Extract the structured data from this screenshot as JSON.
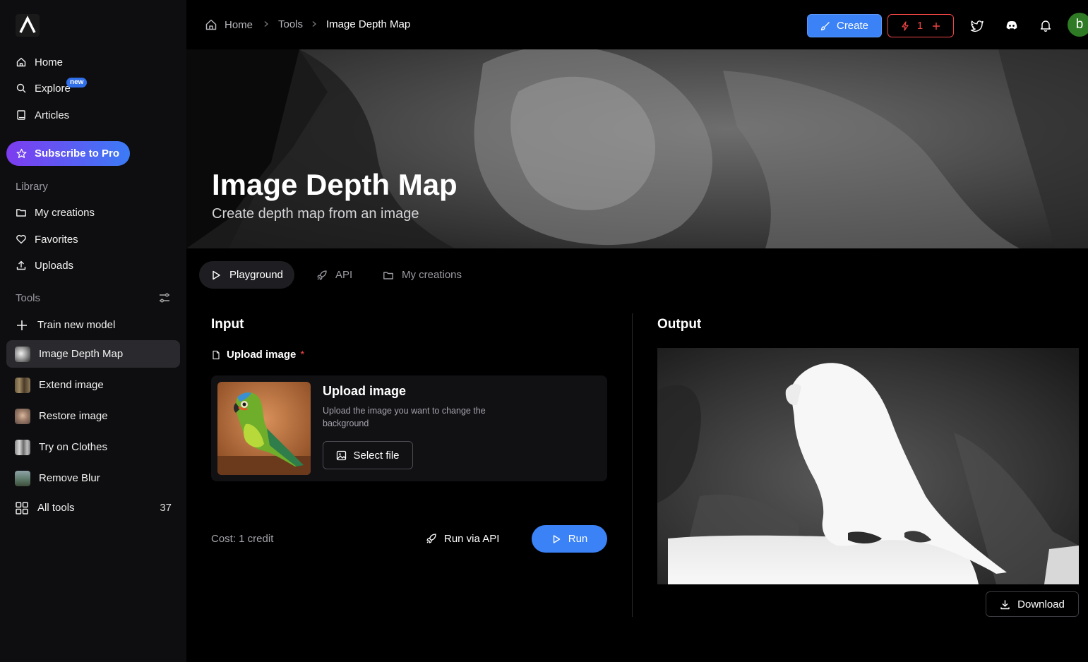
{
  "sidebar": {
    "logo": "app-logo",
    "nav": [
      {
        "label": "Home",
        "icon": "home-icon"
      },
      {
        "label": "Explore",
        "icon": "search-icon",
        "badge": "new"
      },
      {
        "label": "Articles",
        "icon": "book-icon"
      }
    ],
    "pro_button": "Subscribe to Pro",
    "library_label": "Library",
    "library": [
      {
        "label": "My creations",
        "icon": "folder-icon"
      },
      {
        "label": "Favorites",
        "icon": "heart-icon"
      },
      {
        "label": "Uploads",
        "icon": "upload-icon"
      }
    ],
    "tools_label": "Tools",
    "tools": [
      {
        "label": "Train new model",
        "icon": "plus-icon"
      },
      {
        "label": "Image Depth Map",
        "active": true
      },
      {
        "label": "Extend image"
      },
      {
        "label": "Restore image"
      },
      {
        "label": "Try on Clothes"
      },
      {
        "label": "Remove Blur"
      },
      {
        "label": "All tools",
        "icon": "grid-icon",
        "count": "37"
      }
    ]
  },
  "topbar": {
    "breadcrumb": [
      "Home",
      "Tools",
      "Image Depth Map"
    ],
    "create_label": "Create",
    "credits": "1",
    "avatar_letter": "b"
  },
  "hero": {
    "title": "Image Depth Map",
    "subtitle": "Create depth map from an image"
  },
  "tabs": [
    {
      "label": "Playground",
      "icon": "play-icon",
      "active": true
    },
    {
      "label": "API",
      "icon": "rocket-icon"
    },
    {
      "label": "My creations",
      "icon": "folder-icon"
    }
  ],
  "input": {
    "heading": "Input",
    "field_label": "Upload image",
    "required_mark": "*",
    "card_title": "Upload image",
    "card_desc": "Upload the image you want to change the background",
    "select_label": "Select file",
    "cost": "Cost: 1 credit",
    "run_api_label": "Run via API",
    "run_label": "Run"
  },
  "output": {
    "heading": "Output",
    "download_label": "Download"
  },
  "colors": {
    "accent": "#3b82f6",
    "danger": "#ef4444",
    "pro_gradient_start": "#7d3cf0",
    "pro_gradient_end": "#3b7bf6"
  }
}
